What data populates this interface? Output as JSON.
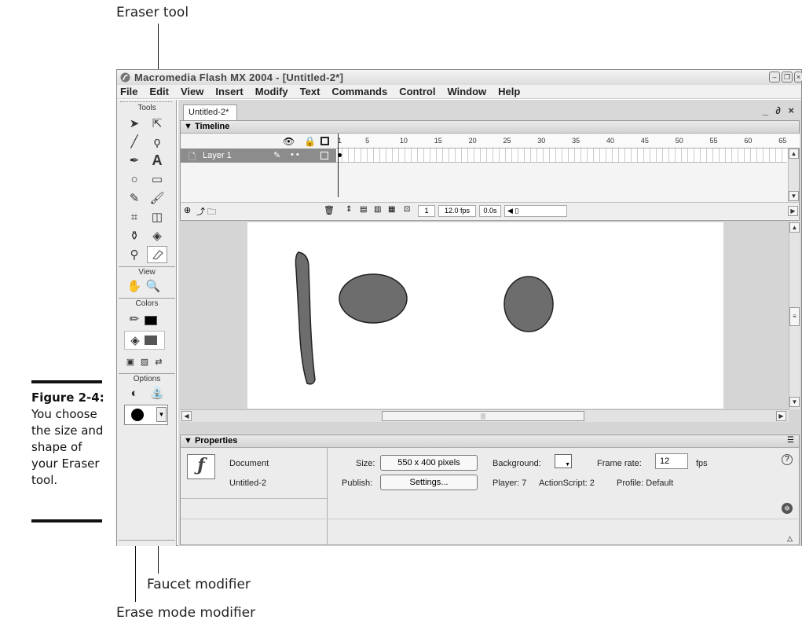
{
  "callouts": {
    "eraser_tool": "Eraser tool",
    "faucet_modifier": "Faucet modifier",
    "erase_mode_modifier": "Erase mode modifier"
  },
  "figure": {
    "label": "Figure 2-4:",
    "caption": "You choose the size and shape of your Eraser tool."
  },
  "window": {
    "title": "Macromedia Flash MX 2004 - [Untitled-2*]",
    "menu": [
      "File",
      "Edit",
      "View",
      "Insert",
      "Modify",
      "Text",
      "Commands",
      "Control",
      "Window",
      "Help"
    ]
  },
  "tools_panel": {
    "title": "Tools",
    "view_label": "View",
    "colors_label": "Colors",
    "options_label": "Options",
    "selected_tool": "eraser",
    "stroke_color": "#000000",
    "fill_color": "#555555"
  },
  "document": {
    "tab": "Untitled-2*",
    "window_controls": "_ ∂ ×"
  },
  "timeline": {
    "header": "▼ Timeline",
    "frame_numbers": [
      "1",
      "5",
      "10",
      "15",
      "20",
      "25",
      "30",
      "35",
      "40",
      "45",
      "50",
      "55",
      "60",
      "65"
    ],
    "layer_name": "Layer 1",
    "current_frame": "1",
    "frame_rate": "12.0 fps",
    "elapsed": "0.0s"
  },
  "stage": {
    "shape_fill": "#6d6d6d",
    "shape_stroke": "#222222"
  },
  "properties": {
    "header": "▼ Properties",
    "type": "Document",
    "name": "Untitled-2",
    "size_label": "Size:",
    "size_value": "550 x 400 pixels",
    "publish_label": "Publish:",
    "settings_button": "Settings...",
    "background_label": "Background:",
    "frame_rate_label": "Frame rate:",
    "frame_rate_value": "12",
    "fps_label": "fps",
    "player_info": "Player: 7",
    "actionscript_info": "ActionScript: 2",
    "profile_info": "Profile: Default"
  }
}
